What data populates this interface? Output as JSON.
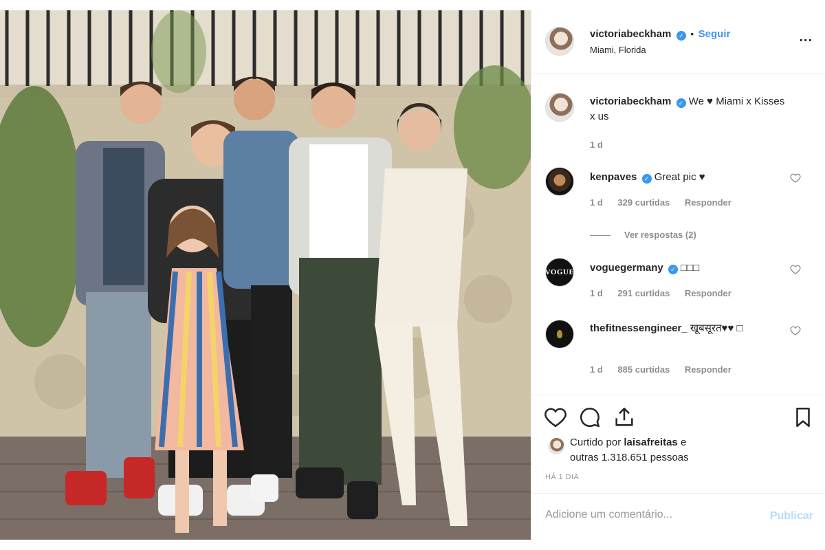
{
  "post": {
    "photo_alt": "",
    "header": {
      "username": "victoriabeckham",
      "follow_label": "Seguir",
      "separator": "•",
      "location": "Miami, Florida",
      "more_label": "..."
    },
    "caption": {
      "username": "victoriabeckham",
      "text": "We ♥ Miami x Kisses x us",
      "age": "1 d"
    },
    "comments": [
      {
        "username": "kenpaves",
        "verified": true,
        "text": "Great pic ♥",
        "age": "1 d",
        "likes": "329 curtidas",
        "reply": "Responder",
        "view_replies": "Ver respostas (2)"
      },
      {
        "username": "voguegermany",
        "verified": true,
        "text": "□□□",
        "age": "1 d",
        "likes": "291 curtidas",
        "reply": "Responder",
        "avatar_text": "VOGUE"
      },
      {
        "username": "thefitnessengineer_",
        "verified": false,
        "text": "खूबसूरत♥♥ □",
        "age": "1 d",
        "likes": "885 curtidas",
        "reply": "Responder"
      }
    ],
    "liked_by": {
      "prefix": "Curtido por",
      "user": "laisafreitas",
      "connector": "e",
      "rest": "outras 1.318.651 pessoas"
    },
    "timestamp": "HÁ 1 DIA",
    "add_comment_placeholder": "Adicione um comentário...",
    "publish_label": "Publicar",
    "colors": {
      "accent": "#3897f0",
      "publish_disabled": "#b3dbff",
      "meta": "#8e8e8e"
    }
  }
}
